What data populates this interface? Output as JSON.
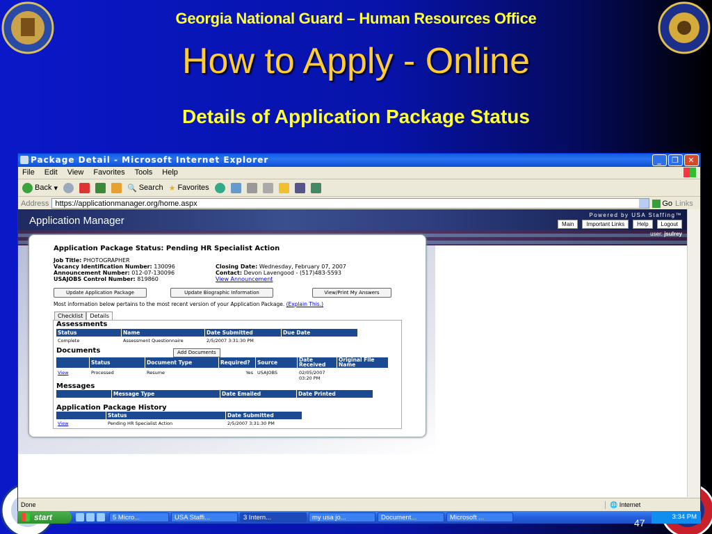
{
  "slide": {
    "org_title": "Georgia National Guard – Human Resources Office",
    "main_title": "How to Apply - Online",
    "sub_title": "Details of Application Package Status",
    "slide_number": "47"
  },
  "seals": {
    "top_left": "georgia-state-seal",
    "top_right": "army-national-guard-seal",
    "bottom_left": "air-national-guard-seal",
    "bottom_right": "guard-seal"
  },
  "browser": {
    "title": "Package Detail - Microsoft Internet Explorer",
    "menu": [
      "File",
      "Edit",
      "View",
      "Favorites",
      "Tools",
      "Help"
    ],
    "toolbar": {
      "back": "Back",
      "search": "Search",
      "favorites": "Favorites"
    },
    "address_label": "Address",
    "address": "https://applicationmanager.org/home.aspx",
    "go": "Go",
    "links": "Links",
    "status_done": "Done",
    "zone": "Internet"
  },
  "app": {
    "name": "Application Manager",
    "powered_by": "Powered by USA Staffing™",
    "nav": [
      "Main",
      "Important Links",
      "Help",
      "Logout"
    ],
    "user_label": "user:",
    "user_name": "jsulrey"
  },
  "package": {
    "title": "Application Package Status: Pending HR Specialist Action",
    "job_title_label": "Job Title:",
    "job_title": "PHOTOGRAPHER",
    "vacancy_label": "Vacancy Identification Number:",
    "vacancy": "130096",
    "announcement_label": "Announcement Number:",
    "announcement": "012-07-130096",
    "control_label": "USAJOBS Control Number:",
    "control": "819860",
    "closing_label": "Closing Date:",
    "closing": "Wednesday, February 07, 2007",
    "contact_label": "Contact:",
    "contact": "Devon Lavengood - (517)483-5593",
    "view_announcement": "View Announcement",
    "buttons": [
      "Update Application Package",
      "Update Biographic Information",
      "View/Print My Answers"
    ],
    "note": "Most information below pertains to the most recent version of your Application Package.",
    "explain": "(Explain This.)",
    "tabs": [
      "Checklist",
      "Details"
    ]
  },
  "assessments": {
    "heading": "Assessments",
    "columns": [
      "Status",
      "Name",
      "Date Submitted",
      "Due Date"
    ],
    "rows": [
      [
        "Complete",
        "Assessment Questionnaire",
        "2/5/2007 3:31:30 PM",
        ""
      ]
    ]
  },
  "documents": {
    "heading": "Documents",
    "add_button": "Add Documents",
    "columns": [
      "",
      "Status",
      "Document Type",
      "Required?",
      "Source",
      "Date Received",
      "Original File Name"
    ],
    "rows": [
      [
        "View",
        "Processed",
        "Resume",
        "Yes",
        "USAJOBS",
        "02/05/2007 03:20 PM",
        ""
      ]
    ]
  },
  "messages": {
    "heading": "Messages",
    "columns": [
      "",
      "Message Type",
      "Date Emailed",
      "Date Printed"
    ]
  },
  "history": {
    "heading": "Application Package History",
    "columns": [
      "",
      "Status",
      "Date Submitted"
    ],
    "rows": [
      [
        "View",
        "Pending HR Specialist Action",
        "2/5/2007 3:31:30 PM"
      ]
    ]
  },
  "taskbar": {
    "start": "start",
    "tasks": [
      "5 Micro...",
      "USA Staffi...",
      "3 Intern...",
      "my usa jo...",
      "Document...",
      "Microsoft ..."
    ],
    "clock": "3:34 PM"
  }
}
